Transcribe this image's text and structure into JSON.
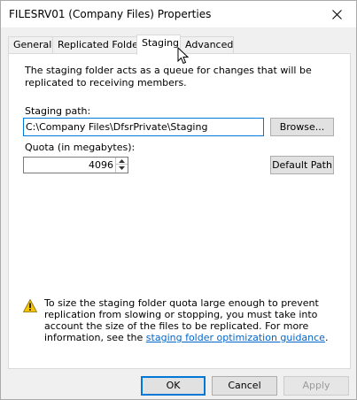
{
  "window": {
    "title": "FILESRV01 (Company Files) Properties",
    "close_icon": "close-icon"
  },
  "tabs": [
    {
      "label": "General",
      "active": false
    },
    {
      "label": "Replicated Folder",
      "active": false
    },
    {
      "label": "Staging",
      "active": true
    },
    {
      "label": "Advanced",
      "active": false
    }
  ],
  "staging": {
    "description": "The staging folder acts as a queue for changes that will be replicated to receiving members.",
    "path_label": "Staging path:",
    "path_value": "C:\\Company Files\\DfsrPrivate\\Staging",
    "browse_label": "Browse...",
    "quota_label": "Quota (in megabytes):",
    "quota_value": "4096",
    "default_path_label": "Default Path",
    "warning_text": "To size the staging folder quota large enough to prevent replication from slowing or stopping, you must take into account the size of the files to be replicated. For more information, see the ",
    "warning_link": "staging folder optimization guidance",
    "warning_end": "."
  },
  "footer": {
    "ok_label": "OK",
    "cancel_label": "Cancel",
    "apply_label": "Apply",
    "apply_enabled": false
  },
  "colors": {
    "accent": "#0078d7",
    "link": "#0066cc",
    "warning": "#f4c400"
  }
}
